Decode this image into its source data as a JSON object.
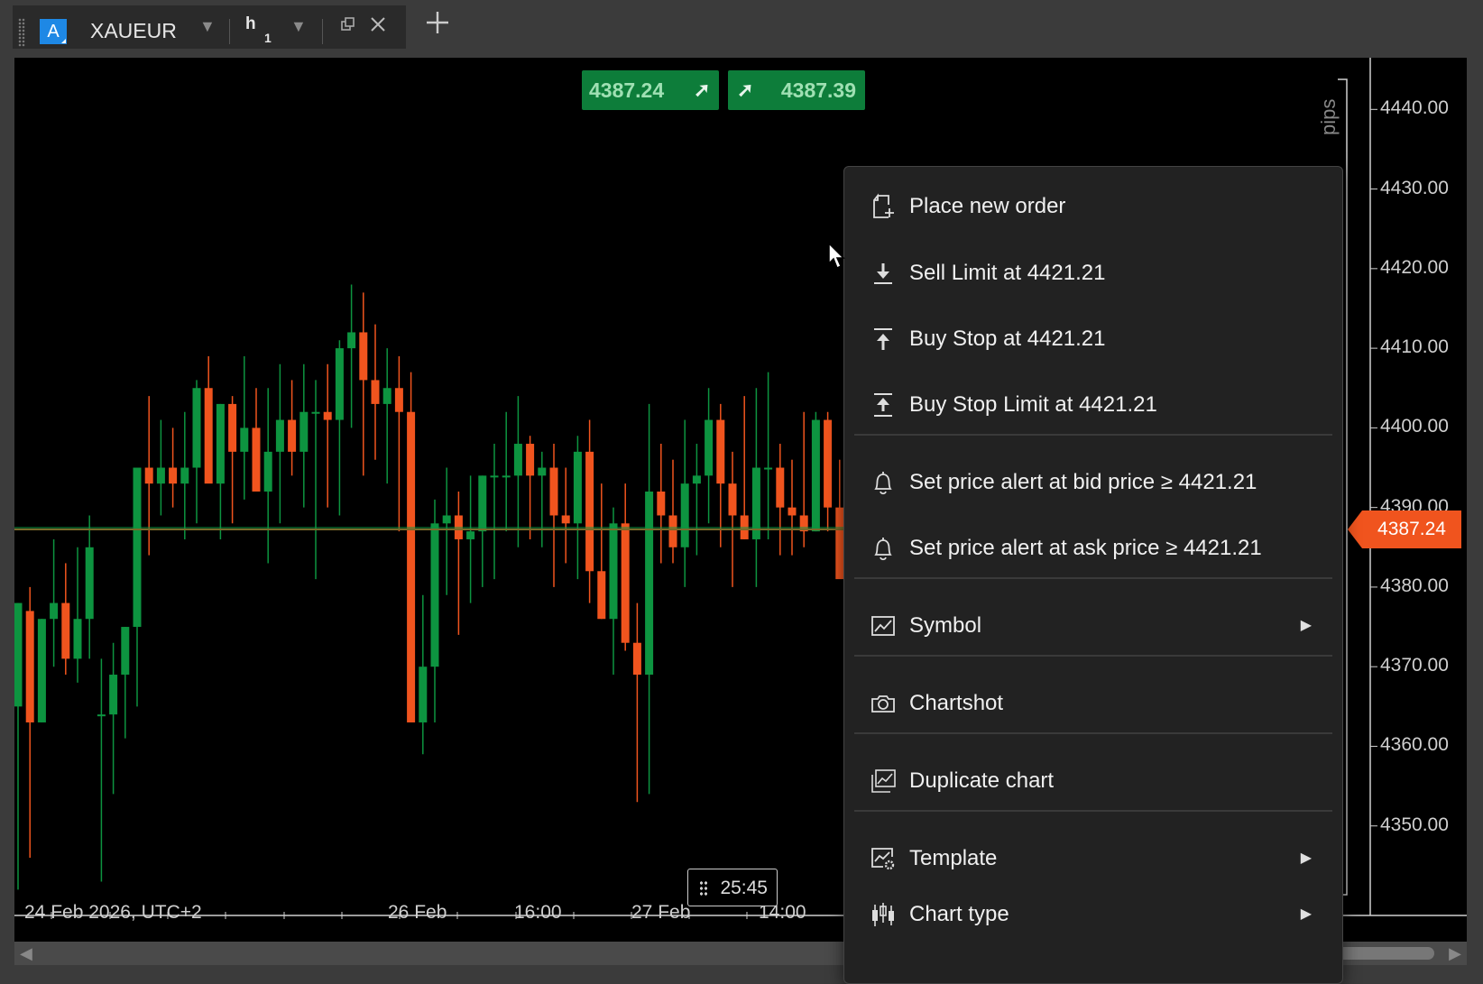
{
  "tab": {
    "symbol_badge": "A",
    "symbol": "XAUEUR",
    "timeframe": "h",
    "timeframe_sub": "1"
  },
  "chart": {
    "bid": "4387.24",
    "ask": "4387.39",
    "current_price": "4387.24",
    "pips_label": "pips",
    "timer": "25:45",
    "y_axis": [
      "4440.00",
      "4430.00",
      "4420.00",
      "4410.00",
      "4400.00",
      "4390.00",
      "4380.00",
      "4370.00",
      "4360.00",
      "4350.00"
    ],
    "x_axis": [
      "24 Feb 2026, UTC+2",
      "26 Feb",
      "16:00",
      "27 Feb",
      "14:00"
    ],
    "colors": {
      "up": "#0d9440",
      "down": "#f0541e",
      "background": "#000000",
      "price_line": "#7a6a2a"
    }
  },
  "chart_data": {
    "type": "candlestick",
    "ylim": [
      4340,
      4444
    ],
    "candles": [
      {
        "o": 4365,
        "h": 4378,
        "l": 4342,
        "c": 4378
      },
      {
        "o": 4377,
        "h": 4380,
        "l": 4346,
        "c": 4363
      },
      {
        "o": 4363,
        "h": 4376,
        "l": 4363,
        "c": 4376
      },
      {
        "o": 4376,
        "h": 4386,
        "l": 4370,
        "c": 4378
      },
      {
        "o": 4378,
        "h": 4383,
        "l": 4369,
        "c": 4371
      },
      {
        "o": 4371,
        "h": 4385,
        "l": 4368,
        "c": 4376
      },
      {
        "o": 4376,
        "h": 4389,
        "l": 4371,
        "c": 4385
      },
      {
        "o": 4364,
        "h": 4371,
        "l": 4343,
        "c": 4364
      },
      {
        "o": 4364,
        "h": 4373,
        "l": 4354,
        "c": 4369
      },
      {
        "o": 4369,
        "h": 4375,
        "l": 4361,
        "c": 4375
      },
      {
        "o": 4375,
        "h": 4393,
        "l": 4365,
        "c": 4395
      },
      {
        "o": 4395,
        "h": 4404,
        "l": 4384,
        "c": 4393
      },
      {
        "o": 4393,
        "h": 4401,
        "l": 4389,
        "c": 4395
      },
      {
        "o": 4395,
        "h": 4400,
        "l": 4390,
        "c": 4393
      },
      {
        "o": 4393,
        "h": 4402,
        "l": 4386,
        "c": 4395
      },
      {
        "o": 4395,
        "h": 4406,
        "l": 4388,
        "c": 4405
      },
      {
        "o": 4405,
        "h": 4409,
        "l": 4394,
        "c": 4393
      },
      {
        "o": 4393,
        "h": 4403,
        "l": 4386,
        "c": 4403
      },
      {
        "o": 4403,
        "h": 4404,
        "l": 4388,
        "c": 4397
      },
      {
        "o": 4397,
        "h": 4409,
        "l": 4391,
        "c": 4400
      },
      {
        "o": 4400,
        "h": 4405,
        "l": 4392,
        "c": 4392
      },
      {
        "o": 4392,
        "h": 4405,
        "l": 4383,
        "c": 4397
      },
      {
        "o": 4397,
        "h": 4408,
        "l": 4388,
        "c": 4401
      },
      {
        "o": 4401,
        "h": 4406,
        "l": 4394,
        "c": 4397
      },
      {
        "o": 4397,
        "h": 4408,
        "l": 4390,
        "c": 4402
      },
      {
        "o": 4402,
        "h": 4406,
        "l": 4381,
        "c": 4402
      },
      {
        "o": 4402,
        "h": 4408,
        "l": 4390,
        "c": 4401
      },
      {
        "o": 4401,
        "h": 4411,
        "l": 4389,
        "c": 4410
      },
      {
        "o": 4410,
        "h": 4418,
        "l": 4400,
        "c": 4412
      },
      {
        "o": 4412,
        "h": 4417,
        "l": 4394,
        "c": 4406
      },
      {
        "o": 4406,
        "h": 4413,
        "l": 4396,
        "c": 4403
      },
      {
        "o": 4403,
        "h": 4410,
        "l": 4393,
        "c": 4405
      },
      {
        "o": 4405,
        "h": 4409,
        "l": 4387,
        "c": 4402
      },
      {
        "o": 4402,
        "h": 4407,
        "l": 4365,
        "c": 4363
      },
      {
        "o": 4363,
        "h": 4379,
        "l": 4359,
        "c": 4370
      },
      {
        "o": 4370,
        "h": 4391,
        "l": 4363,
        "c": 4388
      },
      {
        "o": 4388,
        "h": 4395,
        "l": 4379,
        "c": 4389
      },
      {
        "o": 4389,
        "h": 4392,
        "l": 4374,
        "c": 4386
      },
      {
        "o": 4386,
        "h": 4394,
        "l": 4378,
        "c": 4387
      },
      {
        "o": 4387,
        "h": 4394,
        "l": 4380,
        "c": 4394
      },
      {
        "o": 4394,
        "h": 4398,
        "l": 4381,
        "c": 4394
      },
      {
        "o": 4394,
        "h": 4402,
        "l": 4387,
        "c": 4394
      },
      {
        "o": 4394,
        "h": 4404,
        "l": 4385,
        "c": 4398
      },
      {
        "o": 4398,
        "h": 4399,
        "l": 4386,
        "c": 4394
      },
      {
        "o": 4394,
        "h": 4397,
        "l": 4385,
        "c": 4395
      },
      {
        "o": 4395,
        "h": 4398,
        "l": 4380,
        "c": 4389
      },
      {
        "o": 4389,
        "h": 4395,
        "l": 4383,
        "c": 4388
      },
      {
        "o": 4388,
        "h": 4399,
        "l": 4381,
        "c": 4397
      },
      {
        "o": 4397,
        "h": 4401,
        "l": 4378,
        "c": 4382
      },
      {
        "o": 4382,
        "h": 4393,
        "l": 4376,
        "c": 4376
      },
      {
        "o": 4376,
        "h": 4390,
        "l": 4369,
        "c": 4388
      },
      {
        "o": 4388,
        "h": 4393,
        "l": 4372,
        "c": 4373
      },
      {
        "o": 4373,
        "h": 4378,
        "l": 4353,
        "c": 4369
      },
      {
        "o": 4369,
        "h": 4403,
        "l": 4354,
        "c": 4392
      },
      {
        "o": 4392,
        "h": 4398,
        "l": 4383,
        "c": 4389
      },
      {
        "o": 4389,
        "h": 4396,
        "l": 4383,
        "c": 4385
      },
      {
        "o": 4385,
        "h": 4401,
        "l": 4380,
        "c": 4393
      },
      {
        "o": 4393,
        "h": 4398,
        "l": 4384,
        "c": 4394
      },
      {
        "o": 4394,
        "h": 4405,
        "l": 4388,
        "c": 4401
      },
      {
        "o": 4401,
        "h": 4403,
        "l": 4385,
        "c": 4393
      },
      {
        "o": 4393,
        "h": 4397,
        "l": 4380,
        "c": 4389
      },
      {
        "o": 4389,
        "h": 4404,
        "l": 4386,
        "c": 4386
      },
      {
        "o": 4386,
        "h": 4405,
        "l": 4380,
        "c": 4395
      },
      {
        "o": 4395,
        "h": 4407,
        "l": 4386,
        "c": 4395
      },
      {
        "o": 4395,
        "h": 4398,
        "l": 4384,
        "c": 4390
      },
      {
        "o": 4390,
        "h": 4396,
        "l": 4384,
        "c": 4389
      },
      {
        "o": 4389,
        "h": 4402,
        "l": 4385,
        "c": 4387
      },
      {
        "o": 4387,
        "h": 4402,
        "l": 4387,
        "c": 4401
      },
      {
        "o": 4401,
        "h": 4402,
        "l": 4387,
        "c": 4390
      },
      {
        "o": 4390,
        "h": 4396,
        "l": 4384,
        "c": 4381
      },
      {
        "o": 4381,
        "h": 4386,
        "l": 4379,
        "c": 4385
      },
      {
        "o": 4385,
        "h": 4389,
        "l": 4385,
        "c": 4387
      }
    ]
  },
  "menu": {
    "items": [
      {
        "label": "Place new order",
        "icon": "new-order-icon"
      },
      {
        "label": "Sell Limit at 4421.21",
        "icon": "sell-limit-icon"
      },
      {
        "label": "Buy Stop at 4421.21",
        "icon": "buy-stop-icon"
      },
      {
        "label": "Buy Stop Limit at 4421.21",
        "icon": "buy-stop-limit-icon"
      },
      {
        "label": "Set price alert at bid price ≥ 4421.21",
        "icon": "bell-icon"
      },
      {
        "label": "Set price alert at ask price ≥ 4421.21",
        "icon": "bell-icon"
      },
      {
        "label": "Symbol",
        "icon": "symbol-chart-icon",
        "submenu": "▶"
      },
      {
        "label": "Chartshot",
        "icon": "camera-icon"
      },
      {
        "label": "Duplicate chart",
        "icon": "duplicate-chart-icon"
      },
      {
        "label": "Template",
        "icon": "template-icon",
        "submenu": "▶"
      },
      {
        "label": "Chart type",
        "icon": "chart-type-icon",
        "submenu": "▶"
      }
    ]
  }
}
